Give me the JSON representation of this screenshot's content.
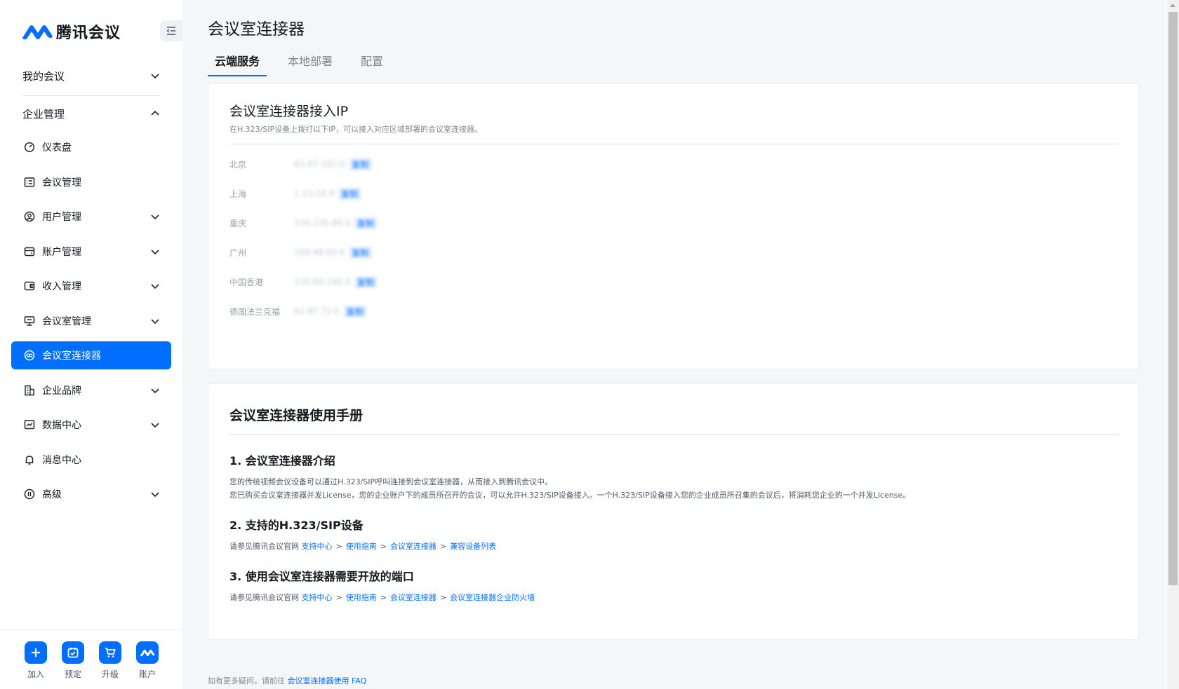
{
  "brand": {
    "name": "腾讯会议",
    "accent": "#006eff"
  },
  "sidebar": {
    "my_meetings": "我的会议",
    "enterprise": "企业管理",
    "items": [
      {
        "label": "仪表盘",
        "icon": "dashboard-icon",
        "expandable": false
      },
      {
        "label": "会议管理",
        "icon": "list-icon",
        "expandable": false
      },
      {
        "label": "用户管理",
        "icon": "user-icon",
        "expandable": true
      },
      {
        "label": "账户管理",
        "icon": "wallet-icon",
        "expandable": true
      },
      {
        "label": "收入管理",
        "icon": "income-icon",
        "expandable": true
      },
      {
        "label": "会议室管理",
        "icon": "meeting-room-icon",
        "expandable": true
      },
      {
        "label": "会议室连接器",
        "icon": "connector-icon",
        "expandable": false,
        "active": true
      },
      {
        "label": "企业品牌",
        "icon": "building-icon",
        "expandable": true
      },
      {
        "label": "数据中心",
        "icon": "chart-icon",
        "expandable": true
      },
      {
        "label": "消息中心",
        "icon": "bell-icon",
        "expandable": false
      },
      {
        "label": "高级",
        "icon": "advanced-icon",
        "expandable": true
      }
    ],
    "bottom": [
      {
        "label": "加入",
        "icon": "plus-icon"
      },
      {
        "label": "预定",
        "icon": "calendar-icon"
      },
      {
        "label": "升级",
        "icon": "cart-icon"
      },
      {
        "label": "账户",
        "icon": "account-icon"
      }
    ]
  },
  "page": {
    "title": "会议室连接器",
    "tabs": [
      "云端服务",
      "本地部署",
      "配置"
    ],
    "active_tab": "云端服务"
  },
  "ip_card": {
    "title": "会议室连接器接入IP",
    "subtitle": "在H.323/SIP设备上拨打以下IP，可以接入对应区域部署的会议室连接器。",
    "rows": [
      {
        "region": "北京",
        "ip": "62.87.182.0",
        "copy": "复制"
      },
      {
        "region": "上海",
        "ip": "1.13.18.0",
        "copy": "复制"
      },
      {
        "region": "重庆",
        "ip": "150.138.80.0",
        "copy": "复制"
      },
      {
        "region": "广州",
        "ip": "109.88.80.0",
        "copy": "复制"
      },
      {
        "region": "中国香港",
        "ip": "120.60.195.0",
        "copy": "复制"
      },
      {
        "region": "德国法兰克福",
        "ip": "62.87.72.0",
        "copy": "复制"
      }
    ]
  },
  "guide": {
    "title": "会议室连接器使用手册",
    "s1_title": "1. 会议室连接器介绍",
    "s1_p1": "您的传统视频会议设备可以通过H.323/SIP呼叫连接到会议室连接器，从而接入到腾讯会议中。",
    "s1_p2": "您已购买会议室连接器并发License，您的企业账户下的成员所召开的会议，可以允许H.323/SIP设备接入。一个H.323/SIP设备接入您的企业成员所召集的会议后，将消耗您企业的一个并发License。",
    "s2_title": "2. 支持的H.323/SIP设备",
    "s3_title": "3. 使用会议室连接器需要开放的端口",
    "ref_prefix": "请参见腾讯会议官网",
    "sep": ">",
    "s2_links": [
      "支持中心",
      "使用指南",
      "会议室连接器",
      "兼容设备列表"
    ],
    "s3_links": [
      "支持中心",
      "使用指南",
      "会议室连接器",
      "会议室连接器企业防火墙"
    ]
  },
  "faq": {
    "prefix": "如有更多疑问，请前往",
    "link": "会议室连接器使用 FAQ"
  }
}
